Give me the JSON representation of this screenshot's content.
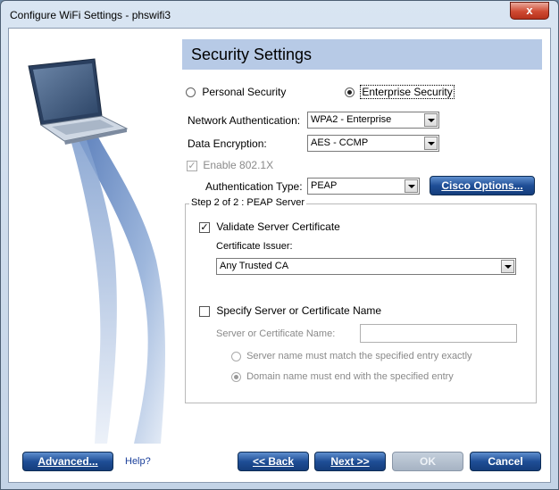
{
  "window": {
    "title": "Configure WiFi Settings - phswifi3",
    "close_glyph": "x"
  },
  "header": {
    "title": "Security Settings"
  },
  "security_mode": {
    "personal_label": "Personal Security",
    "enterprise_label": "Enterprise Security",
    "selected": "enterprise"
  },
  "network_auth": {
    "label": "Network Authentication:",
    "value": "WPA2 - Enterprise"
  },
  "data_encryption": {
    "label": "Data Encryption:",
    "value": "AES - CCMP"
  },
  "enable_8021x": {
    "label": "Enable 802.1X",
    "checked": true,
    "enabled": false
  },
  "auth_type": {
    "label": "Authentication Type:",
    "value": "PEAP"
  },
  "cisco_options": {
    "label": "Cisco Options..."
  },
  "step_group": {
    "legend": "Step 2 of 2 : PEAP Server",
    "validate_cert": {
      "label": "Validate Server Certificate",
      "checked": true
    },
    "cert_issuer_label": "Certificate Issuer:",
    "cert_issuer_value": "Any Trusted CA",
    "specify_server": {
      "label": "Specify Server or Certificate Name",
      "checked": false
    },
    "server_name_label": "Server or Certificate Name:",
    "server_name_value": "",
    "match_exact_label": "Server name must match the specified entry exactly",
    "domain_end_label": "Domain name must end with the specified entry",
    "selected_match": "domain"
  },
  "footer": {
    "advanced_label": "Advanced...",
    "help_label": "Help?",
    "back_label": "<< Back",
    "next_label": "Next >>",
    "ok_label": "OK",
    "cancel_label": "Cancel"
  },
  "colors": {
    "header_bar": "#b7cae6",
    "button_blue": "#1f4e96",
    "art_ribbon": "#6f8fc4"
  },
  "icons": [
    "laptop-illustration",
    "close-icon",
    "dropdown-arrow-icon"
  ]
}
